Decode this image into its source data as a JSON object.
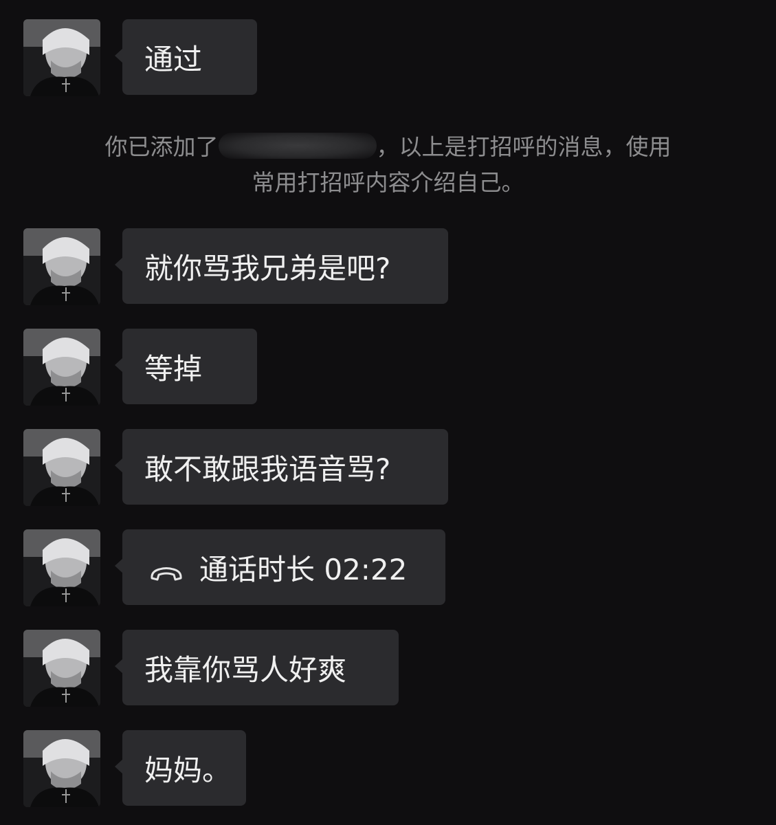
{
  "system_notice": {
    "before_name": "你已添加了",
    "after_name": "，以上是打招呼的消息，使用",
    "line2": "常用打招呼内容介绍自己。"
  },
  "messages": [
    {
      "text": "通过"
    },
    {
      "text": "就你骂我兄弟是吧?"
    },
    {
      "text": "等掉"
    },
    {
      "text": "敢不敢跟我语音骂?"
    },
    {
      "text": "通话时长 02:22",
      "icon": "phone-hangup-icon"
    },
    {
      "text": "我靠你骂人好爽"
    },
    {
      "text": "妈妈。"
    }
  ]
}
